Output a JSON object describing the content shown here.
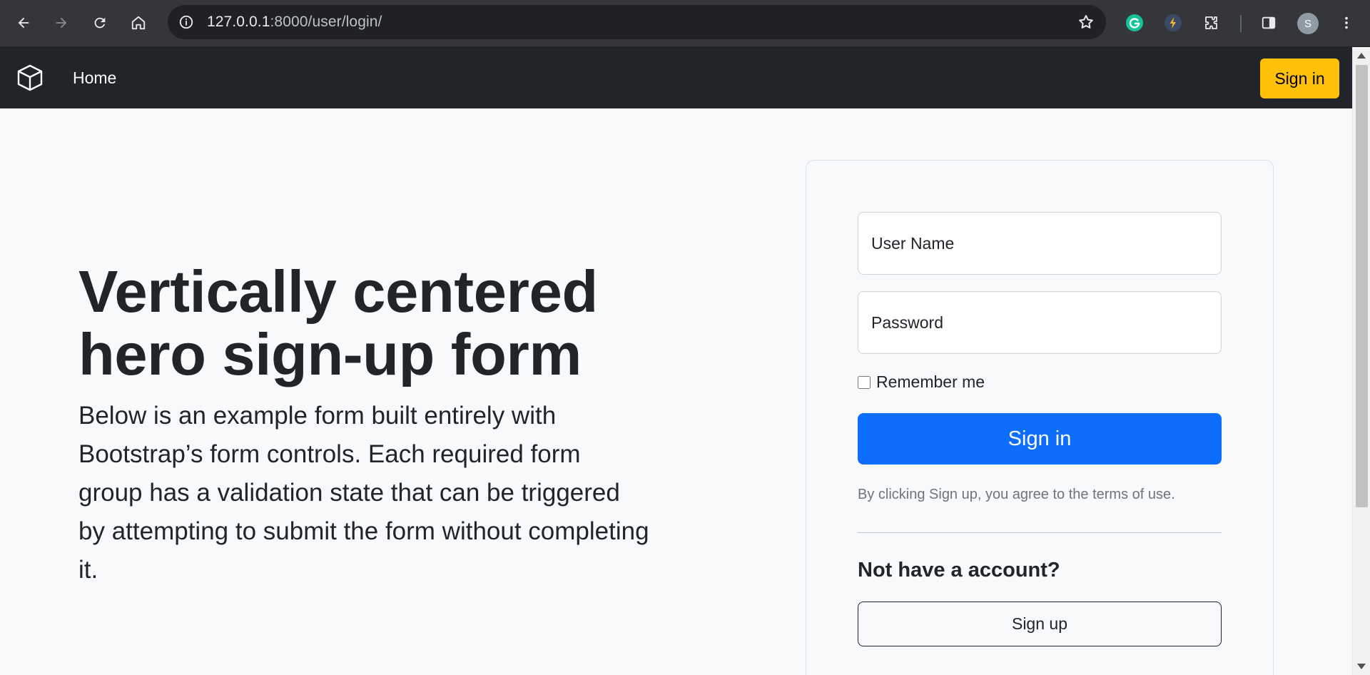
{
  "browser": {
    "url_host": "127.0.0.1",
    "url_rest": ":8000/user/login/",
    "profile_initial": "S"
  },
  "navbar": {
    "home_label": "Home",
    "signin_label": "Sign in",
    "signin_color": "#ffc107"
  },
  "hero": {
    "title": "Vertically centered hero sign-up form",
    "lead": "Below is an example form built entirely with Bootstrap’s form controls. Each required form group has a validation state that can be triggered by attempting to submit the form without completing it."
  },
  "form": {
    "username_placeholder": "User Name",
    "username_value": "",
    "password_placeholder": "Password",
    "password_value": "",
    "remember_label": "Remember me",
    "remember_checked": false,
    "submit_label": "Sign in",
    "submit_color": "#0d6efd",
    "terms_text": "By clicking Sign up, you agree to the terms of use.",
    "no_account_heading": "Not have a account?",
    "signup_label": "Sign up"
  }
}
